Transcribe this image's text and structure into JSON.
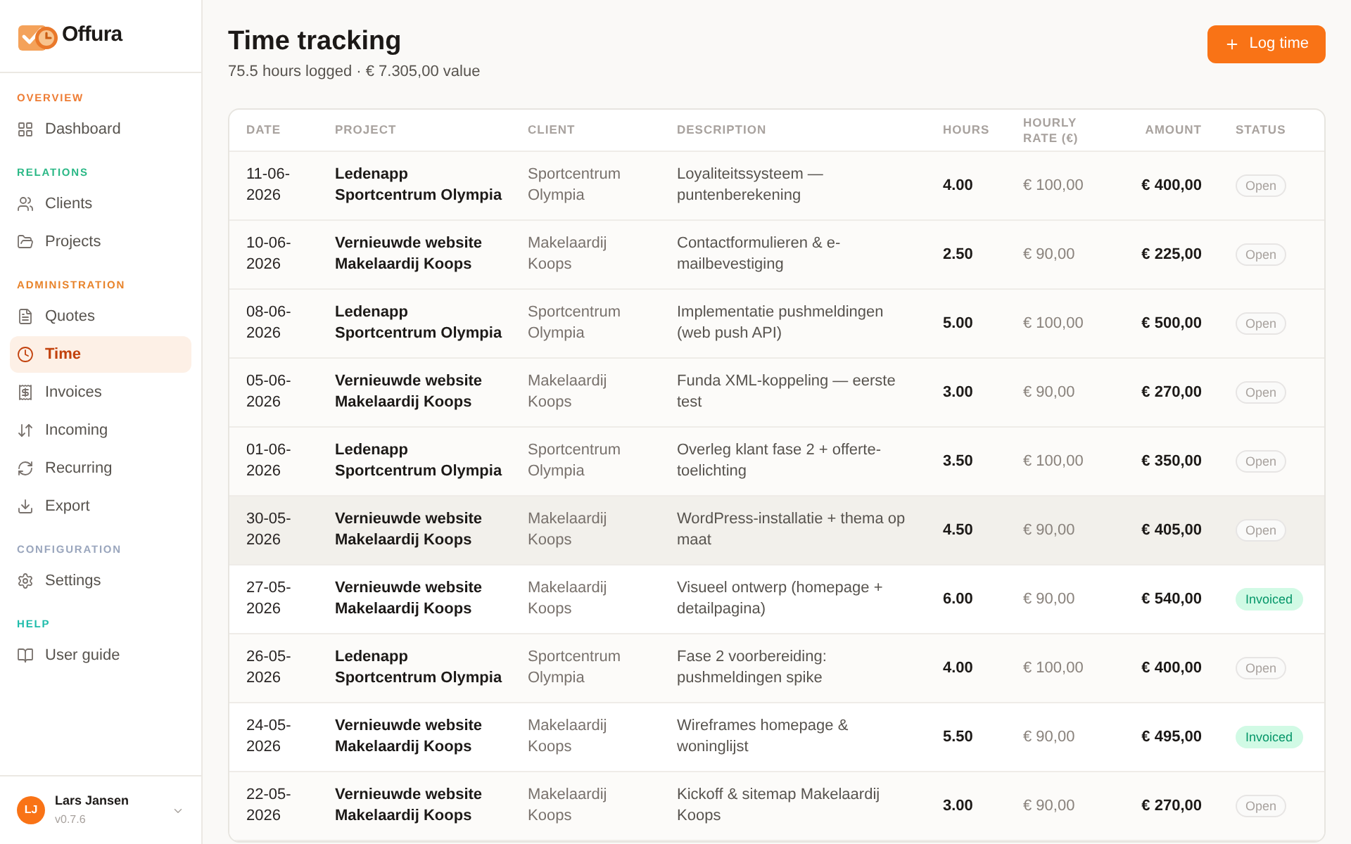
{
  "app": {
    "name": "Offura"
  },
  "sidebar": {
    "sections": [
      {
        "heading": "OVERVIEW",
        "color": "#ee7d35",
        "items": [
          {
            "label": "Dashboard",
            "selected": false
          }
        ]
      },
      {
        "heading": "RELATIONS",
        "color": "#2bb886",
        "items": [
          {
            "label": "Clients",
            "selected": false
          },
          {
            "label": "Projects",
            "selected": false
          }
        ]
      },
      {
        "heading": "ADMINISTRATION",
        "color": "#e8832a",
        "items": [
          {
            "label": "Quotes",
            "selected": false
          },
          {
            "label": "Time",
            "selected": true
          },
          {
            "label": "Invoices",
            "selected": false
          },
          {
            "label": "Incoming",
            "selected": false
          },
          {
            "label": "Recurring",
            "selected": false
          },
          {
            "label": "Export",
            "selected": false
          }
        ]
      },
      {
        "heading": "CONFIGURATION",
        "color": "#9aa6bd",
        "items": [
          {
            "label": "Settings",
            "selected": false
          }
        ]
      },
      {
        "heading": "HELP",
        "color": "#1fbcab",
        "items": [
          {
            "label": "User guide",
            "selected": false
          }
        ]
      }
    ]
  },
  "user": {
    "initials": "LJ",
    "name": "Lars Jansen",
    "version": "v0.7.6"
  },
  "page": {
    "title": "Time tracking",
    "subtitle": "75.5 hours logged · € 7.305,00 value",
    "action": "Log time"
  },
  "table": {
    "columns": [
      "DATE",
      "PROJECT",
      "CLIENT",
      "DESCRIPTION",
      "HOURS",
      "HOURLY RATE (€)",
      "AMOUNT",
      "STATUS"
    ],
    "rows": [
      {
        "date": "11-06-2026",
        "project": "Ledenapp",
        "project_client": "Sportcentrum Olympia",
        "client": "Sportcentrum Olympia",
        "description": "Loyaliteitssysteem — puntenberekening",
        "hours": "4.00",
        "rate": "€ 100,00",
        "amount": "€ 400,00",
        "status": {
          "kind": "open",
          "label": "Open"
        },
        "highlighted": false
      },
      {
        "date": "10-06-2026",
        "project": "Vernieuwde website",
        "project_client": "Makelaardij Koops",
        "client": "Makelaardij Koops",
        "description": "Contactformulieren & e-mailbevestiging",
        "hours": "2.50",
        "rate": "€ 90,00",
        "amount": "€ 225,00",
        "status": {
          "kind": "open",
          "label": "Open"
        },
        "highlighted": false
      },
      {
        "date": "08-06-2026",
        "project": "Ledenapp",
        "project_client": "Sportcentrum Olympia",
        "client": "Sportcentrum Olympia",
        "description": "Implementatie pushmeldingen (web push API)",
        "hours": "5.00",
        "rate": "€ 100,00",
        "amount": "€ 500,00",
        "status": {
          "kind": "open",
          "label": "Open"
        },
        "highlighted": false
      },
      {
        "date": "05-06-2026",
        "project": "Vernieuwde website",
        "project_client": "Makelaardij Koops",
        "client": "Makelaardij Koops",
        "description": "Funda XML-koppeling — eerste test",
        "hours": "3.00",
        "rate": "€ 90,00",
        "amount": "€ 270,00",
        "status": {
          "kind": "open",
          "label": "Open"
        },
        "highlighted": false
      },
      {
        "date": "01-06-2026",
        "project": "Ledenapp",
        "project_client": "Sportcentrum Olympia",
        "client": "Sportcentrum Olympia",
        "description": "Overleg klant fase 2 + offerte-toelichting",
        "hours": "3.50",
        "rate": "€ 100,00",
        "amount": "€ 350,00",
        "status": {
          "kind": "open",
          "label": "Open"
        },
        "highlighted": false
      },
      {
        "date": "30-05-2026",
        "project": "Vernieuwde website",
        "project_client": "Makelaardij Koops",
        "client": "Makelaardij Koops",
        "description": "WordPress-installatie + thema op maat",
        "hours": "4.50",
        "rate": "€ 90,00",
        "amount": "€ 405,00",
        "status": {
          "kind": "open",
          "label": "Open"
        },
        "highlighted": true
      },
      {
        "date": "27-05-2026",
        "project": "Vernieuwde website",
        "project_client": "Makelaardij Koops",
        "client": "Makelaardij Koops",
        "description": "Visueel ontwerp (homepage + detailpagina)",
        "hours": "6.00",
        "rate": "€ 90,00",
        "amount": "€ 540,00",
        "status": {
          "kind": "invoiced",
          "label": "Invoiced"
        },
        "highlighted": false
      },
      {
        "date": "26-05-2026",
        "project": "Ledenapp",
        "project_client": "Sportcentrum Olympia",
        "client": "Sportcentrum Olympia",
        "description": "Fase 2 voorbereiding: pushmeldingen spike",
        "hours": "4.00",
        "rate": "€ 100,00",
        "amount": "€ 400,00",
        "status": {
          "kind": "open",
          "label": "Open"
        },
        "highlighted": false
      },
      {
        "date": "24-05-2026",
        "project": "Vernieuwde website",
        "project_client": "Makelaardij Koops",
        "client": "Makelaardij Koops",
        "description": "Wireframes homepage & woninglijst",
        "hours": "5.50",
        "rate": "€ 90,00",
        "amount": "€ 495,00",
        "status": {
          "kind": "invoiced",
          "label": "Invoiced"
        },
        "highlighted": false
      },
      {
        "date": "22-05-2026",
        "project": "Vernieuwde website",
        "project_client": "Makelaardij Koops",
        "client": "Makelaardij Koops",
        "description": "Kickoff & sitemap Makelaardij Koops",
        "hours": "3.00",
        "rate": "€ 90,00",
        "amount": "€ 270,00",
        "status": {
          "kind": "open",
          "label": "Open"
        },
        "highlighted": false
      }
    ]
  }
}
